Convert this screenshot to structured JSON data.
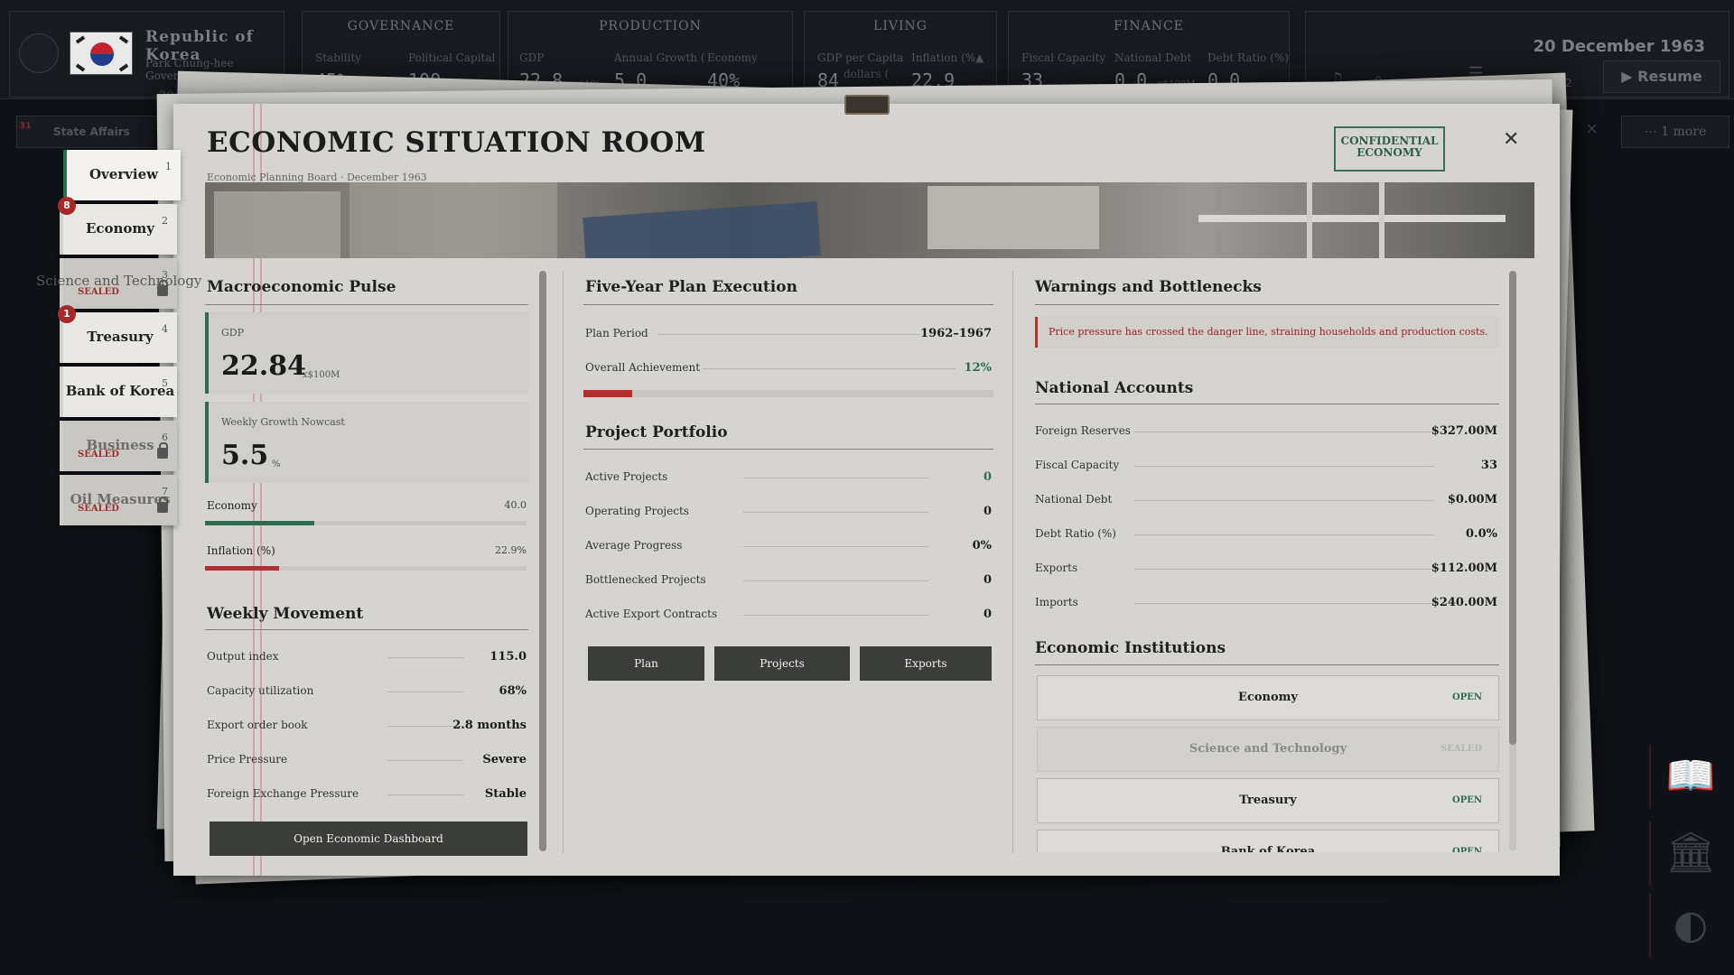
{
  "hud": {
    "nation": {
      "name": "Republic of Korea",
      "government": "Park Chung-hee Governme",
      "count": "20"
    },
    "groups": [
      {
        "title": "GOVERNANCE",
        "stats": [
          {
            "label": "Stability",
            "value": "45%"
          },
          {
            "label": "Political Capital",
            "value": "100"
          }
        ]
      },
      {
        "title": "PRODUCTION",
        "stats": [
          {
            "label": "GDP",
            "value": "22.8",
            "unit": "x$10("
          },
          {
            "label": "Annual Growth (",
            "value": "5.0"
          },
          {
            "label": "Economy",
            "value": "40%"
          }
        ]
      },
      {
        "title": "LIVING",
        "stats": [
          {
            "label": "GDP per Capita",
            "sublabel": "dollars (",
            "value": "84"
          },
          {
            "label": "Inflation (%",
            "value": "22.9"
          }
        ]
      },
      {
        "title": "FINANCE",
        "stats": [
          {
            "label": "Fiscal Capacity",
            "value": "33"
          },
          {
            "label": "National Debt",
            "value": "0.0",
            "unit": "x$100M"
          },
          {
            "label": "Debt Ratio (%)",
            "value": "0.0"
          }
        ]
      }
    ],
    "date": "20 December 1963",
    "speed": "x2",
    "resume_label": "Resume"
  },
  "subbar": {
    "state_affairs": "State Affairs",
    "state_affairs_count": "31",
    "more": "1 more"
  },
  "tabs": [
    {
      "label": "Overview",
      "num": "1",
      "state": "active"
    },
    {
      "label": "Economy",
      "num": "2",
      "badge": "8"
    },
    {
      "label": "",
      "num": "3",
      "sealed": "SEALED"
    },
    {
      "label": "Treasury",
      "num": "4",
      "badge": "1"
    },
    {
      "label": "Bank of Korea",
      "num": "5"
    },
    {
      "label": "Business",
      "num": "6",
      "sealed": "SEALED"
    },
    {
      "label": "Oil Measures",
      "num": "7",
      "sealed": "SEALED"
    }
  ],
  "floating_label": "Science and Technology",
  "header": {
    "title": "ECONOMIC SITUATION ROOM",
    "subtitle": "Economic Planning Board · December 1963",
    "stamp_line1": "CONFIDENTIAL",
    "stamp_line2": "ECONOMY"
  },
  "left": {
    "pulse_title": "Macroeconomic Pulse",
    "gdp": {
      "label": "GDP",
      "value": "22.84",
      "unit": "x$100M"
    },
    "growth": {
      "label": "Weekly Growth Nowcast",
      "value": "5.5",
      "unit": "%"
    },
    "economy_bar": {
      "label": "Economy",
      "value": "40.0",
      "fraction": 0.34,
      "color": "#2e6b4f"
    },
    "inflation_bar": {
      "label": "Inflation (%)",
      "value": "22.9%",
      "fraction": 0.229,
      "color": "#b03030"
    },
    "movement_title": "Weekly Movement",
    "movement": [
      {
        "k": "Output index",
        "v": "115.0"
      },
      {
        "k": "Capacity utilization",
        "v": "68%"
      },
      {
        "k": "Export order book",
        "v": "2.8 months"
      },
      {
        "k": "Price Pressure",
        "v": "Severe"
      },
      {
        "k": "Foreign Exchange Pressure",
        "v": "Stable"
      }
    ],
    "dashboard_button": "Open Economic Dashboard"
  },
  "middle": {
    "plan_title": "Five-Year Plan Execution",
    "plan_period_label": "Plan Period",
    "plan_period": "1962–1967",
    "achievement_label": "Overall Achievement",
    "achievement": "12%",
    "achievement_fraction": 0.12,
    "portfolio_title": "Project Portfolio",
    "portfolio": [
      {
        "k": "Active Projects",
        "v": "0",
        "accent": true
      },
      {
        "k": "Operating Projects",
        "v": "0"
      },
      {
        "k": "Average Progress",
        "v": "0%"
      },
      {
        "k": "Bottlenecked Projects",
        "v": "0"
      },
      {
        "k": "Active Export Contracts",
        "v": "0"
      }
    ],
    "buttons": [
      "Plan",
      "Projects",
      "Exports"
    ]
  },
  "right": {
    "warnings_title": "Warnings and Bottlenecks",
    "warning": "Price pressure has crossed the danger line, straining households and production costs.",
    "accounts_title": "National Accounts",
    "accounts": [
      {
        "k": "Foreign Reserves",
        "v": "$327.00M"
      },
      {
        "k": "Fiscal Capacity",
        "v": "33"
      },
      {
        "k": "National Debt",
        "v": "$0.00M"
      },
      {
        "k": "Debt Ratio (%)",
        "v": "0.0%"
      },
      {
        "k": "Exports",
        "v": "$112.00M"
      },
      {
        "k": "Imports",
        "v": "$240.00M"
      }
    ],
    "institutions_title": "Economic Institutions",
    "institutions": [
      {
        "name": "Economy",
        "status": "OPEN"
      },
      {
        "name": "Science and Technology",
        "status": "SEALED"
      },
      {
        "name": "Treasury",
        "status": "OPEN"
      },
      {
        "name": "Bank of Korea",
        "status": "OPEN"
      }
    ]
  },
  "colors": {
    "accent_green": "#2e6b4f",
    "danger_red": "#b03030",
    "paper": "#d6d5d2"
  }
}
